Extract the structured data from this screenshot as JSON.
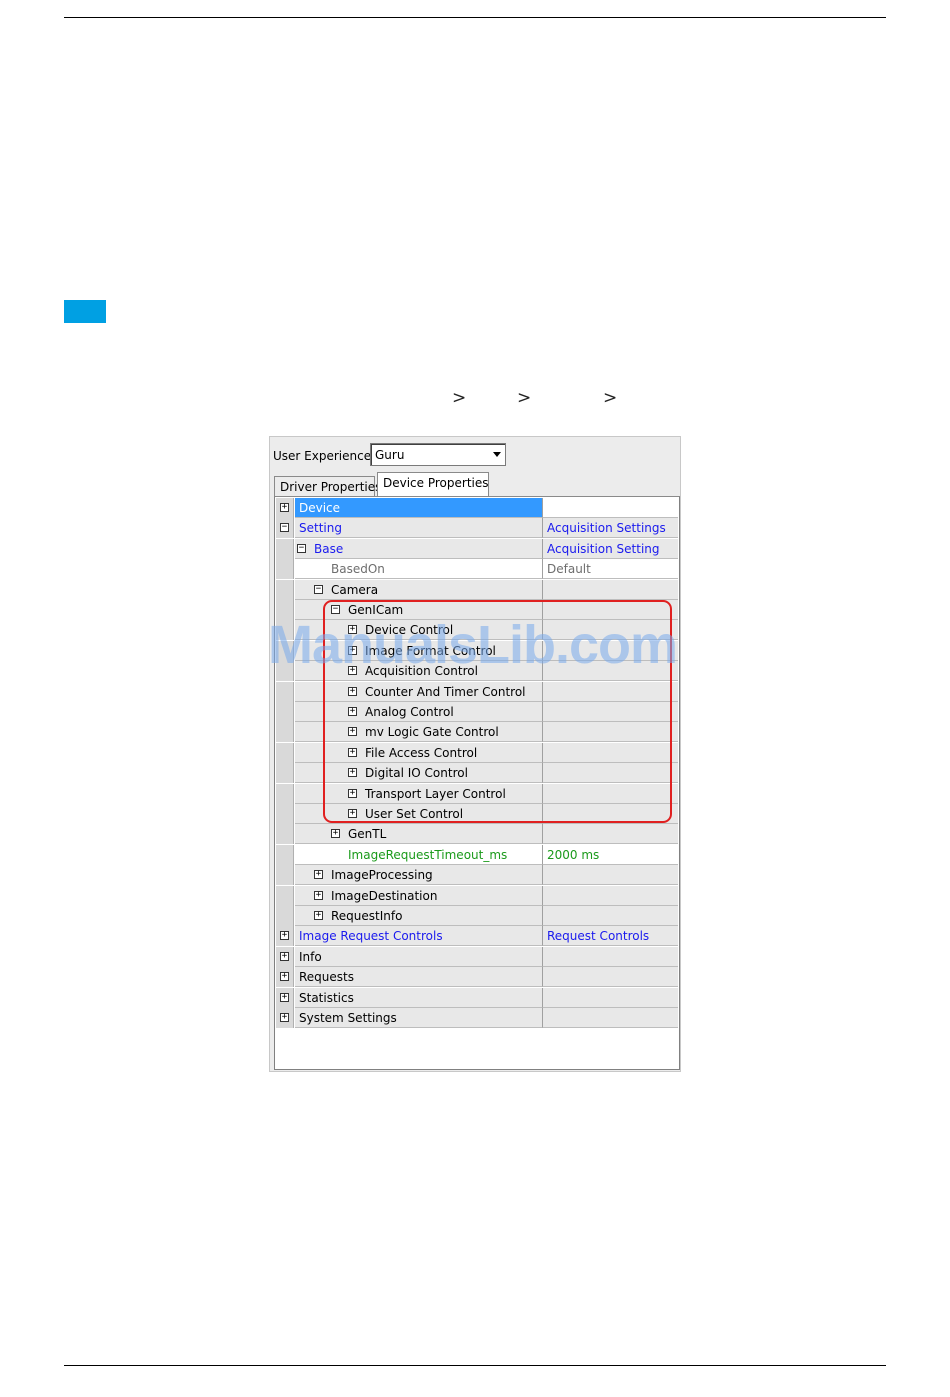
{
  "breadcrumb": [
    ">",
    ">",
    ">"
  ],
  "panel": {
    "user_experience_label": "User Experience:",
    "user_experience_value": "Guru",
    "tabs": [
      "Driver Properties",
      "Device Properties"
    ]
  },
  "tree": [
    {
      "name": "Device",
      "value": "",
      "expander": "+",
      "style": "selected"
    },
    {
      "name": "Setting",
      "value": "Acquisition Settings",
      "expander": "−",
      "style": "blue"
    },
    {
      "name": "Base",
      "value": "Acquisition Setting",
      "expander": "−",
      "style": "blue"
    },
    {
      "name": "BasedOn",
      "value": "Default",
      "expander": "",
      "style": "grey"
    },
    {
      "name": "Camera",
      "value": "",
      "expander": "−",
      "style": "normal"
    },
    {
      "name": "GenICam",
      "value": "",
      "expander": "−",
      "style": "normal"
    },
    {
      "name": "Device Control",
      "value": "",
      "expander": "+",
      "style": "normal"
    },
    {
      "name": "Image Format Control",
      "value": "",
      "expander": "+",
      "style": "normal"
    },
    {
      "name": "Acquisition Control",
      "value": "",
      "expander": "+",
      "style": "normal"
    },
    {
      "name": "Counter And Timer Control",
      "value": "",
      "expander": "+",
      "style": "normal"
    },
    {
      "name": "Analog Control",
      "value": "",
      "expander": "+",
      "style": "normal"
    },
    {
      "name": "mv Logic Gate Control",
      "value": "",
      "expander": "+",
      "style": "normal"
    },
    {
      "name": "File Access Control",
      "value": "",
      "expander": "+",
      "style": "normal"
    },
    {
      "name": "Digital IO Control",
      "value": "",
      "expander": "+",
      "style": "normal"
    },
    {
      "name": "Transport Layer Control",
      "value": "",
      "expander": "+",
      "style": "normal"
    },
    {
      "name": "User Set Control",
      "value": "",
      "expander": "+",
      "style": "normal"
    },
    {
      "name": "GenTL",
      "value": "",
      "expander": "+",
      "style": "normal"
    },
    {
      "name": "ImageRequestTimeout_ms",
      "value": "2000 ms",
      "expander": "",
      "style": "green"
    },
    {
      "name": "ImageProcessing",
      "value": "",
      "expander": "+",
      "style": "normal"
    },
    {
      "name": "ImageDestination",
      "value": "",
      "expander": "+",
      "style": "normal"
    },
    {
      "name": "RequestInfo",
      "value": "",
      "expander": "+",
      "style": "normal"
    },
    {
      "name": "Image Request Controls",
      "value": "Request Controls",
      "expander": "+",
      "style": "blue"
    },
    {
      "name": "Info",
      "value": "",
      "expander": "+",
      "style": "normal"
    },
    {
      "name": "Requests",
      "value": "",
      "expander": "+",
      "style": "normal"
    },
    {
      "name": "Statistics",
      "value": "",
      "expander": "+",
      "style": "normal"
    },
    {
      "name": "System Settings",
      "value": "",
      "expander": "+",
      "style": "normal"
    }
  ],
  "watermark": "ManualsLib.com",
  "colors": {
    "section_marker": "#00a0e3",
    "selection": "#3399ff",
    "highlight_box": "#e02020",
    "blue_text": "#1a1aee",
    "green_text": "#1a9a1a"
  }
}
